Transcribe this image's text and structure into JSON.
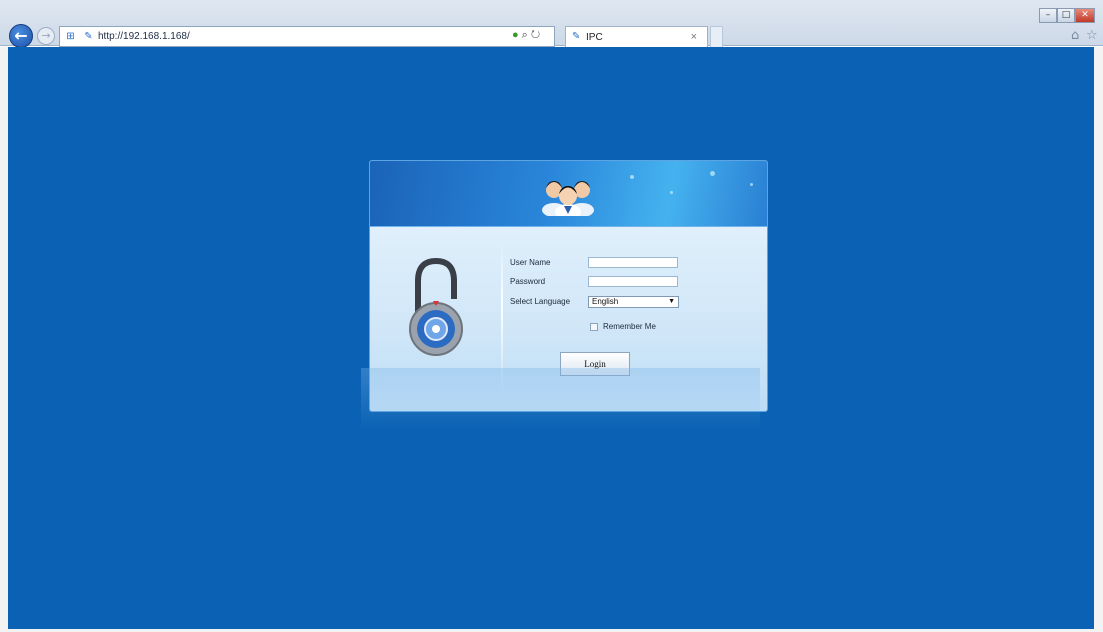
{
  "browser": {
    "url": "http://192.168.1.168/",
    "tab_title": "IPC",
    "tab_close": "×",
    "win_minimize": "–",
    "win_maximize": "□",
    "win_close": "✕"
  },
  "login": {
    "username_label": "User Name",
    "password_label": "Password",
    "language_label": "Select Language",
    "language_selected": "English",
    "remember_label": "Remember Me",
    "login_button": "Login"
  },
  "colors": {
    "page_background": "#0b62b4",
    "panel_header": "#2a86da",
    "panel_body": "#cfe6f8"
  }
}
